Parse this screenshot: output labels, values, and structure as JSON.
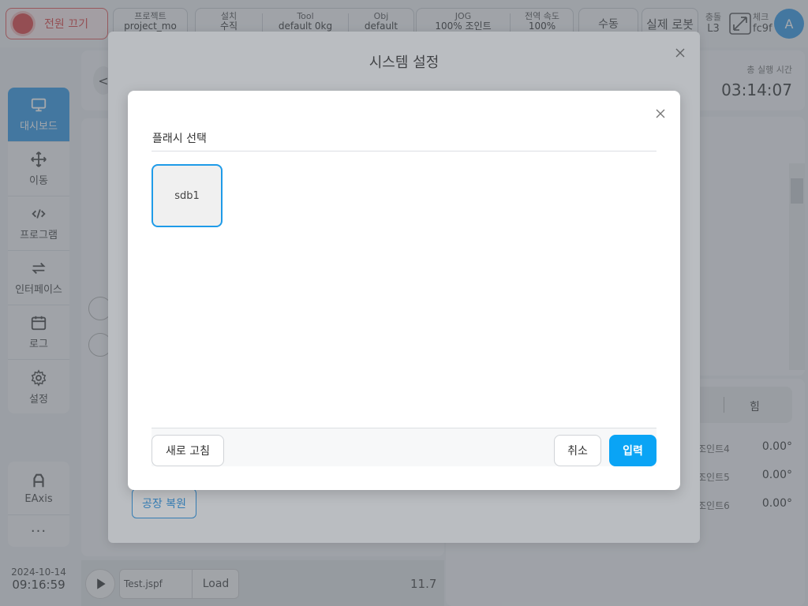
{
  "topbar": {
    "power_label": "전원 끄기",
    "project": {
      "label": "프로젝트",
      "value": "project_mo"
    },
    "install": {
      "label": "설치",
      "value": "수직"
    },
    "tool": {
      "label": "Tool",
      "value": "default    0kg"
    },
    "obj": {
      "label": "Obj",
      "value": "default"
    },
    "jog": {
      "label": "JOG",
      "value": "100%   조인트"
    },
    "global_speed": {
      "label": "전역 속도",
      "value": "100%"
    },
    "mode": "수동",
    "robot": "실제 로봇",
    "collision": {
      "label": "충돌",
      "value": "L3"
    },
    "check": {
      "label": "체크",
      "value": "fc9f"
    },
    "avatar": "A"
  },
  "nav": {
    "items": [
      {
        "label": "대시보드",
        "icon": "monitor-icon"
      },
      {
        "label": "이동",
        "icon": "move-icon"
      },
      {
        "label": "프로그램",
        "icon": "code-icon"
      },
      {
        "label": "인터페이스",
        "icon": "swap-icon"
      },
      {
        "label": "로그",
        "icon": "calendar-icon"
      },
      {
        "label": "설정",
        "icon": "gear-icon"
      }
    ],
    "eaxis_label": "EAxis",
    "more_label": "···"
  },
  "status": {
    "date": "2024-10-14",
    "time": "09:16:59",
    "runtime_label": "총 실행 시간",
    "runtime_value": "03:14:07"
  },
  "background": {
    "back_glyph": "<",
    "force_tab": "힘",
    "joints": [
      {
        "label": "조인트4",
        "value": "0.00°"
      },
      {
        "label": "조인트5",
        "value": "0.00°"
      },
      {
        "label": "조인트6",
        "value": "0.00°"
      }
    ],
    "factory_reset": "공장 복원",
    "file_name": "Test.jspf",
    "load_label": "Load",
    "speed_value": "11.7"
  },
  "system_modal": {
    "title": "시스템 설정"
  },
  "flash_modal": {
    "title": "플래시 선택",
    "drives": [
      "sdb1"
    ],
    "refresh_label": "새로 고침",
    "cancel_label": "취소",
    "enter_label": "입력"
  },
  "colors": {
    "accent": "#0aa4f5",
    "nav_active": "#1f8fe3",
    "power_red": "#d93232"
  }
}
